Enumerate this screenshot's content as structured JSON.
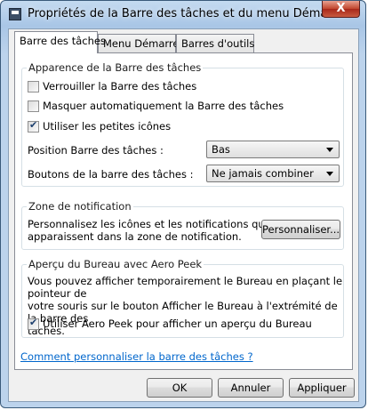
{
  "window": {
    "title": "Propriétés de la Barre des tâches et du menu Démarrer",
    "close_label": "X"
  },
  "tabs": [
    {
      "label": "Barre des tâches",
      "active": true
    },
    {
      "label": "Menu Démarrer",
      "active": false
    },
    {
      "label": "Barres d'outils",
      "active": false
    }
  ],
  "appearance": {
    "title": "Apparence de la Barre des tâches",
    "checkboxes": [
      {
        "label": "Verrouiller la Barre des tâches",
        "checked": false
      },
      {
        "label": "Masquer automatiquement la Barre des tâches",
        "checked": false
      },
      {
        "label": "Utiliser les petites icônes",
        "checked": true
      }
    ],
    "position_label": "Position Barre des tâches :",
    "position_value": "Bas",
    "buttons_label": "Boutons de la barre des tâches :",
    "buttons_value": "Ne jamais combiner"
  },
  "notification": {
    "title": "Zone de notification",
    "text_line1": "Personnalisez les icônes et les notifications qui",
    "text_line2": "apparaissent dans la zone de notification.",
    "button_label": "Personnaliser..."
  },
  "aero_peek": {
    "title": "Aperçu du Bureau avec Aero Peek",
    "text_line1": "Vous pouvez afficher temporairement le Bureau en plaçant le pointeur de",
    "text_line2": "votre souris sur le bouton Afficher le Bureau à l'extrémité de la barre des",
    "text_line3": "tâches.",
    "checkbox_label": "Utiliser Aero Peek pour afficher un aperçu du Bureau",
    "checkbox_checked": true
  },
  "help_link": "Comment personnaliser la barre des tâches ?",
  "footer": {
    "ok_label": "OK",
    "cancel_label": "Annuler",
    "apply_label": "Appliquer"
  }
}
